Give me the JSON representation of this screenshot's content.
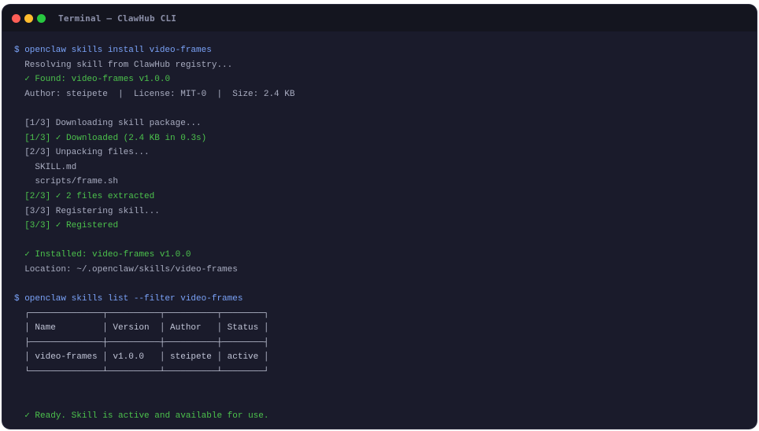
{
  "window": {
    "title": "Terminal — ClawHub CLI"
  },
  "lines": [
    {
      "text": "$ openclaw skills install video-frames",
      "kind": "prompt"
    },
    {
      "text": "  Resolving skill from ClawHub registry...",
      "kind": "dim"
    },
    {
      "text": "  ✓ Found: video-frames v1.0.0",
      "kind": "ok"
    },
    {
      "text": "  Author: steipete  |  License: MIT-0  |  Size: 2.4 KB",
      "kind": "dim"
    },
    {
      "text": "",
      "kind": "dim"
    },
    {
      "text": "  [1/3] Downloading skill package...",
      "kind": "dim"
    },
    {
      "text": "  [1/3] ✓ Downloaded (2.4 KB in 0.3s)",
      "kind": "ok"
    },
    {
      "text": "  [2/3] Unpacking files...",
      "kind": "dim"
    },
    {
      "text": "    SKILL.md",
      "kind": "dim"
    },
    {
      "text": "    scripts/frame.sh",
      "kind": "dim"
    },
    {
      "text": "  [2/3] ✓ 2 files extracted",
      "kind": "ok"
    },
    {
      "text": "  [3/3] Registering skill...",
      "kind": "dim"
    },
    {
      "text": "  [3/3] ✓ Registered",
      "kind": "ok"
    },
    {
      "text": "",
      "kind": "dim"
    },
    {
      "text": "  ✓ Installed: video-frames v1.0.0",
      "kind": "ok"
    },
    {
      "text": "  Location: ~/.openclaw/skills/video-frames",
      "kind": "dim"
    },
    {
      "text": "",
      "kind": "dim"
    },
    {
      "text": "$ openclaw skills list --filter video-frames",
      "kind": "prompt"
    },
    {
      "text": "  ┌──────────────┬──────────┬──────────┬────────┐",
      "kind": "tbl"
    },
    {
      "text": "  │ Name         │ Version  │ Author   │ Status │",
      "kind": "tbl"
    },
    {
      "text": "  ├──────────────┼──────────┼──────────┼────────┤",
      "kind": "tbl"
    },
    {
      "text": "  │ video-frames │ v1.0.0   │ steipete │ active │",
      "kind": "tbl"
    },
    {
      "text": "  └──────────────┴──────────┴──────────┴────────┘",
      "kind": "tbl"
    },
    {
      "text": "",
      "kind": "dim"
    },
    {
      "text": "",
      "kind": "dim"
    },
    {
      "text": "  ✓ Ready. Skill is active and available for use.",
      "kind": "ok"
    }
  ],
  "colors": {
    "prompt": "#7aa2f7",
    "ok": "#4cc24c",
    "dim": "#a9adc1",
    "background": "#1a1b2b"
  }
}
